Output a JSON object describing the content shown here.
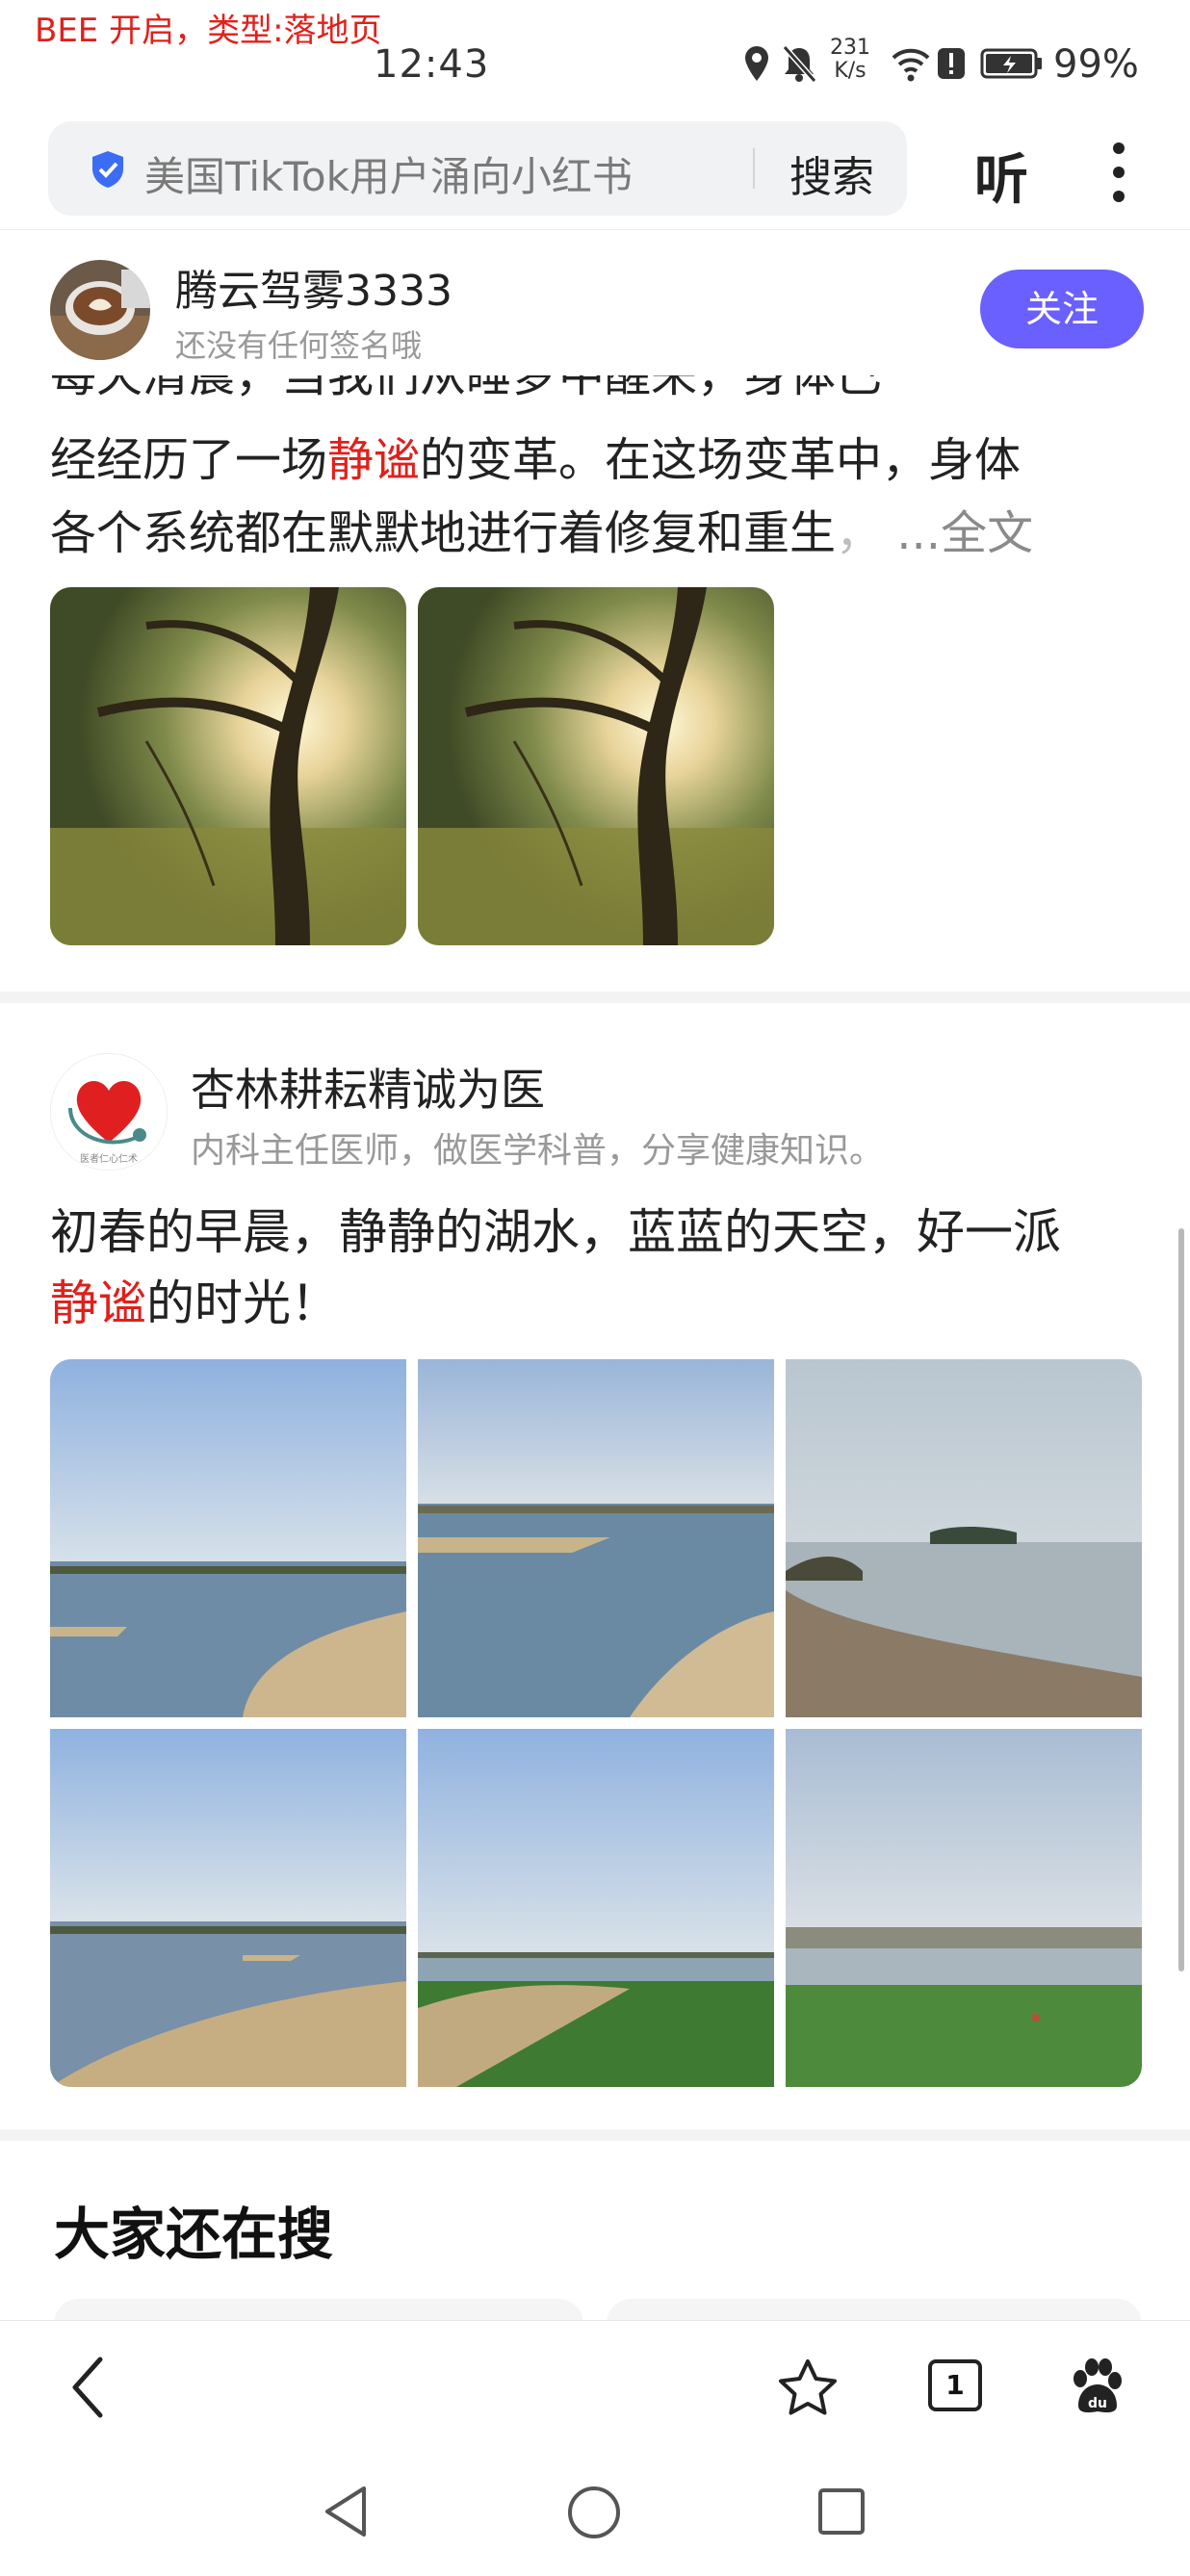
{
  "status_bar": {
    "debug_label": "BEE 开启，类型:落地页",
    "time": "12:43",
    "net_speed_value": "231",
    "net_speed_unit": "K/s",
    "battery": "99%"
  },
  "search": {
    "query": "美国TikTok用户涌向小红书",
    "search_button": "搜索",
    "listen_button": "听"
  },
  "post1": {
    "author": "腾云驾雾3333",
    "signature": "还没有任何签名哦",
    "follow_button": "关注",
    "clipped_line": "每天清晨，当我们从睡梦中醒来，身体已",
    "line2_a": "经经历了一场",
    "line2_hl": "静谧",
    "line2_b": "的变革。在这场变革中，身体",
    "line3": "各个系统都在默默地进行着修复和重生",
    "line3_comma": "，",
    "more": " ...全文"
  },
  "post2": {
    "author": "杏林耕耘精诚为医",
    "signature": "内科主任医师，做医学科普，分享健康知识。",
    "avatar_caption": "医者仁心仁术",
    "line1": "初春的早晨，静静的湖水，蓝蓝的天空，好一派",
    "line2_hl": "静谧",
    "line2_b": "的时光！"
  },
  "section": {
    "title": "大家还在搜"
  },
  "bottom_nav": {
    "tab_count": "1"
  },
  "colors": {
    "accent": "#6a5fff",
    "highlight": "#e0201b",
    "shield": "#3b6cf6"
  }
}
